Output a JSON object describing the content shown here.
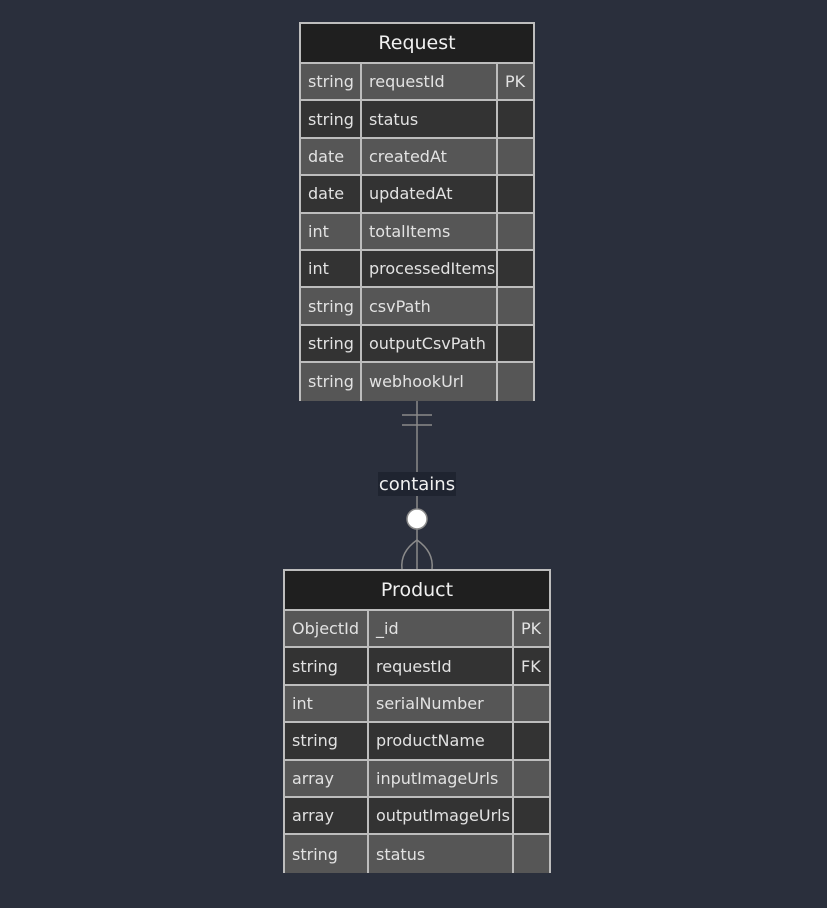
{
  "entities": {
    "request": {
      "title": "Request",
      "attributes": [
        {
          "type": "string",
          "name": "requestId",
          "key": "PK"
        },
        {
          "type": "string",
          "name": "status",
          "key": ""
        },
        {
          "type": "date",
          "name": "createdAt",
          "key": ""
        },
        {
          "type": "date",
          "name": "updatedAt",
          "key": ""
        },
        {
          "type": "int",
          "name": "totalItems",
          "key": ""
        },
        {
          "type": "int",
          "name": "processedItems",
          "key": ""
        },
        {
          "type": "string",
          "name": "csvPath",
          "key": ""
        },
        {
          "type": "string",
          "name": "outputCsvPath",
          "key": ""
        },
        {
          "type": "string",
          "name": "webhookUrl",
          "key": ""
        }
      ]
    },
    "product": {
      "title": "Product",
      "attributes": [
        {
          "type": "ObjectId",
          "name": "_id",
          "key": "PK"
        },
        {
          "type": "string",
          "name": "requestId",
          "key": "FK"
        },
        {
          "type": "int",
          "name": "serialNumber",
          "key": ""
        },
        {
          "type": "string",
          "name": "productName",
          "key": ""
        },
        {
          "type": "array",
          "name": "inputImageUrls",
          "key": ""
        },
        {
          "type": "array",
          "name": "outputImageUrls",
          "key": ""
        },
        {
          "type": "string",
          "name": "status",
          "key": ""
        }
      ]
    }
  },
  "relationship": {
    "label": "contains",
    "from_cardinality": "exactly-one",
    "to_cardinality": "zero-or-more"
  },
  "colors": {
    "background": "#2a2f3c",
    "header": "#1f1f1f",
    "row_odd": "#565656",
    "row_even": "#333333",
    "border": "#bdbdbd",
    "line": "#8a8a8a"
  }
}
